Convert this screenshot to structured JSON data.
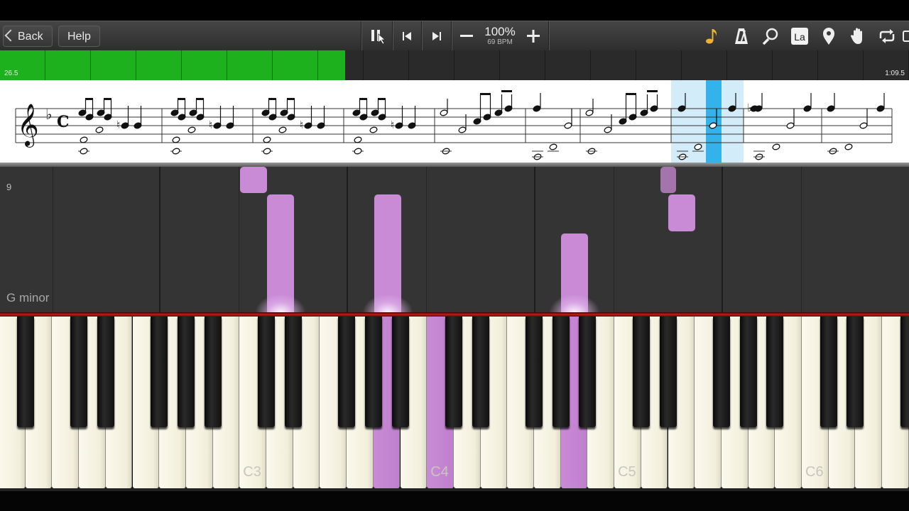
{
  "toolbar": {
    "back_label": "Back",
    "help_label": "Help",
    "zoom": "100%",
    "bpm": "69 BPM",
    "icons": [
      "pause-icon",
      "skip-back-icon",
      "skip-forward-icon",
      "minus-icon",
      "plus-icon",
      "note-icon",
      "metronome-icon",
      "magnifier-icon",
      "note-labels-icon",
      "location-pin-icon",
      "hand-icon",
      "loop-icon"
    ],
    "note_labels_text": "La"
  },
  "progress": {
    "start_time": "26.5",
    "end_time": "1:09.5",
    "fraction": 0.38,
    "fill_color": "#1db21d"
  },
  "falls": {
    "measure_number": "9",
    "key_signature": "G minor",
    "note_color": "#c98bd6"
  },
  "keyboard": {
    "octave_labels": [
      "C3",
      "C4",
      "C5",
      "C6"
    ],
    "pressed_keys": [
      "A3",
      "C4",
      "A4"
    ]
  }
}
